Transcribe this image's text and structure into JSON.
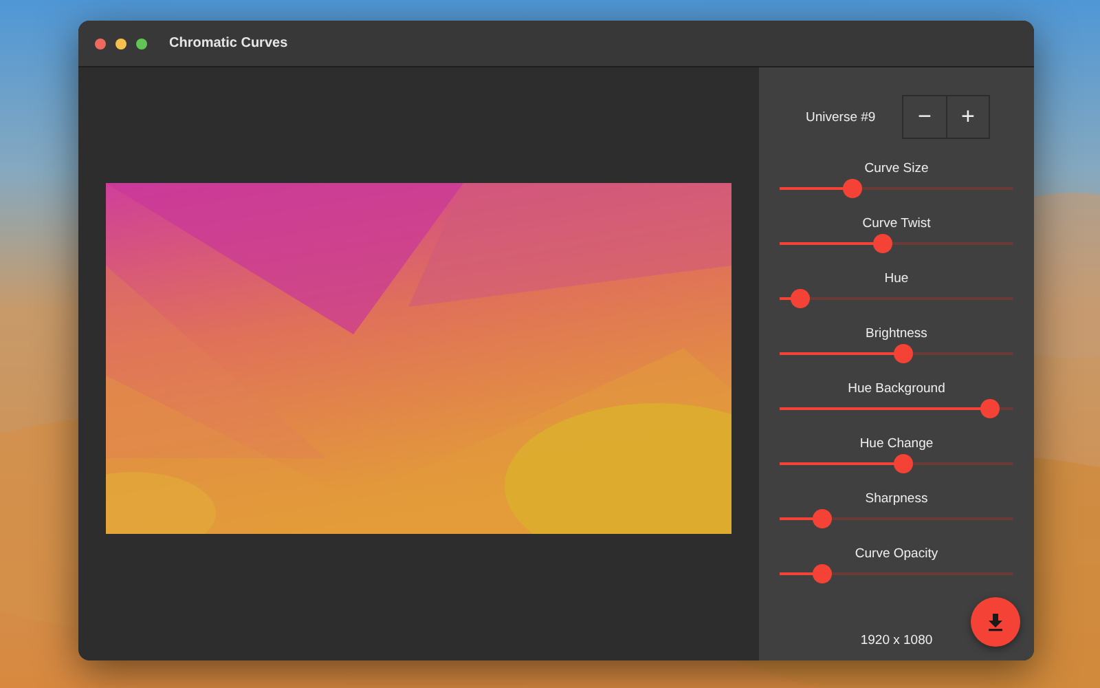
{
  "window": {
    "title": "Chromatic Curves"
  },
  "universe": {
    "label": "Universe #9",
    "decrement": "−",
    "increment": "+"
  },
  "sliders": [
    {
      "label": "Curve Size",
      "level": 0.31
    },
    {
      "label": "Curve Twist",
      "level": 0.44
    },
    {
      "label": "Hue",
      "level": 0.09
    },
    {
      "label": "Brightness",
      "level": 0.53
    },
    {
      "label": "Hue Background",
      "level": 0.9
    },
    {
      "label": "Hue Change",
      "level": 0.53
    },
    {
      "label": "Sharpness",
      "level": 0.18
    },
    {
      "label": "Curve Opacity",
      "level": 0.18
    }
  ],
  "resolution": "1920 x 1080"
}
